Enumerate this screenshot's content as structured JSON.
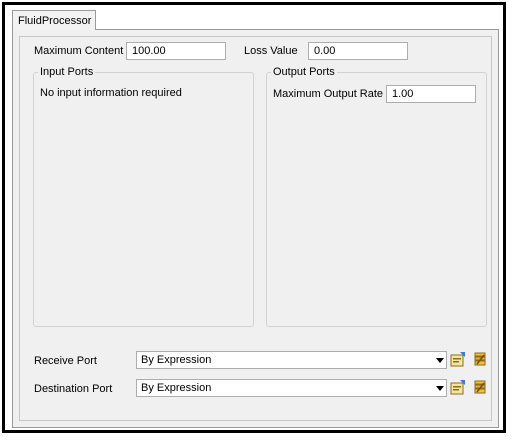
{
  "tab": {
    "label": "FluidProcessor"
  },
  "top_fields": {
    "max_content_label": "Maximum Content",
    "max_content_value": "100.00",
    "loss_value_label": "Loss Value",
    "loss_value_value": "0.00"
  },
  "input_ports": {
    "title": "Input Ports",
    "message": "No input information required"
  },
  "output_ports": {
    "title": "Output Ports",
    "max_output_rate_label": "Maximum Output Rate",
    "max_output_rate_value": "1.00"
  },
  "receive_port": {
    "label": "Receive Port",
    "value": "By Expression",
    "icons": [
      "properties-icon",
      "script-edit-icon"
    ]
  },
  "destination_port": {
    "label": "Destination Port",
    "value": "By Expression",
    "icons": [
      "properties-icon",
      "script-edit-icon"
    ]
  },
  "colors": {
    "panel_bg": "#f0f0f0",
    "border": "#9a9a9a",
    "field_border": "#adadad"
  }
}
